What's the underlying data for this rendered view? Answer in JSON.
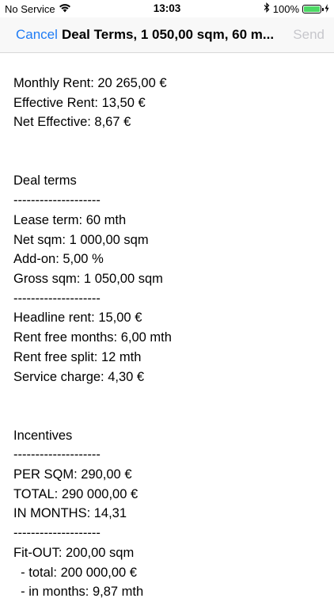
{
  "status_bar": {
    "carrier": "No Service",
    "time": "13:03",
    "battery": "100%",
    "battery_level": 1.0,
    "icons": [
      "wifi-icon",
      "bluetooth-icon",
      "battery-icon",
      "charging-icon"
    ]
  },
  "nav": {
    "left": "Cancel",
    "title": "Deal Terms, 1 050,00 sqm, 60 m...",
    "right": "Send",
    "accent_color": "#1f7cf5",
    "disabled_color": "#c7c7cc"
  },
  "report": [
    "Monthly Rent: 20 265,00 €",
    "Effective Rent: 13,50 €",
    "Net Effective: 8,67 €",
    "",
    "",
    "Deal terms",
    "--------------------",
    "Lease term: 60 mth",
    "Net sqm: 1 000,00 sqm",
    "Add-on: 5,00 %",
    "Gross sqm: 1 050,00 sqm",
    "--------------------",
    "Headline rent: 15,00 €",
    "Rent free months: 6,00 mth",
    "Rent free split: 12 mth",
    "Service charge: 4,30 €",
    "",
    "",
    "Incentives",
    "--------------------",
    "PER SQM: 290,00 €",
    "TOTAL: 290 000,00 €",
    "IN MONTHS: 14,31",
    "--------------------",
    "Fit-OUT: 200,00 sqm",
    "  - total: 200 000,00 €",
    "  - in months: 9,87 mth"
  ]
}
